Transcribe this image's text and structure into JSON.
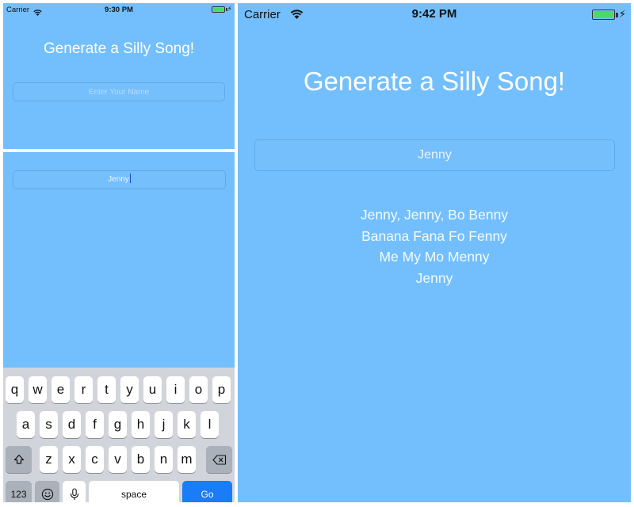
{
  "status_left": {
    "carrier": "Carrier",
    "time": "9:30 PM"
  },
  "status_right": {
    "carrier": "Carrier",
    "time": "9:42 PM"
  },
  "app": {
    "title": "Generate a Silly Song!"
  },
  "name_input": {
    "placeholder": "Enter Your Name",
    "value": "Jenny"
  },
  "lyrics": [
    "Jenny, Jenny, Bo Benny",
    "Banana Fana Fo Fenny",
    "Me My Mo Menny",
    "Jenny"
  ],
  "keyboard": {
    "row1": [
      "q",
      "w",
      "e",
      "r",
      "t",
      "y",
      "u",
      "i",
      "o",
      "p"
    ],
    "row2": [
      "a",
      "s",
      "d",
      "f",
      "g",
      "h",
      "j",
      "k",
      "l"
    ],
    "row3": [
      "z",
      "x",
      "c",
      "v",
      "b",
      "n",
      "m"
    ],
    "numbers_label": "123",
    "space_label": "space",
    "go_label": "Go"
  },
  "colors": {
    "background": "#73bffd",
    "go_key": "#1a7cf9",
    "battery": "#4cd964"
  },
  "icons": [
    "wifi-icon",
    "battery-icon",
    "charging-bolt-icon",
    "shift-icon",
    "delete-icon",
    "emoji-icon",
    "microphone-icon"
  ]
}
